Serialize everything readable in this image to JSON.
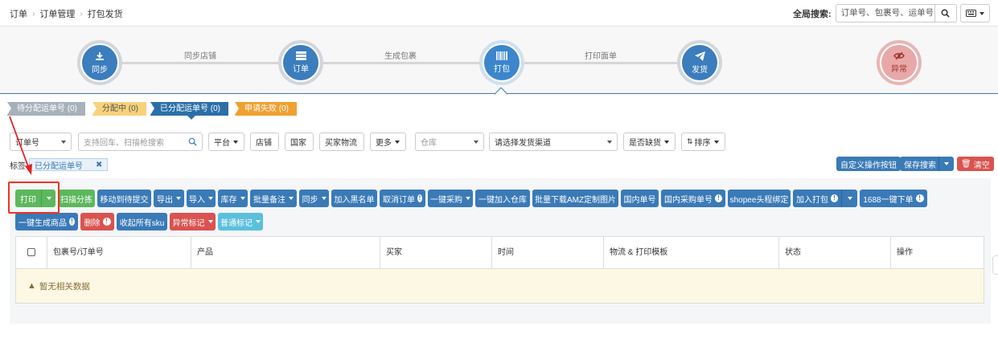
{
  "breadcrumb": [
    "订单",
    "订单管理",
    "打包发货"
  ],
  "global_search": {
    "label": "全局搜索:",
    "placeholder": "订单号、包裹号、运单号",
    "search_icon": "search-icon",
    "keyboard_icon": "keyboard-icon"
  },
  "steps": [
    {
      "label": "同步",
      "icon": "download-icon"
    },
    {
      "label": "订单",
      "icon": "list-icon"
    },
    {
      "label": "打包",
      "icon": "barcode-icon",
      "active": true
    },
    {
      "label": "发货",
      "icon": "paper-plane-icon"
    },
    {
      "label": "异常",
      "icon": "eye-slash-icon"
    }
  ],
  "step_links": [
    "同步店铺",
    "生成包裹",
    "打印面单"
  ],
  "status_tabs": [
    {
      "label": "待分配运单号 (0)"
    },
    {
      "label": "分配中 (0)"
    },
    {
      "label": "已分配运单号 (0)",
      "active": true
    },
    {
      "label": "申请失败 (0)"
    }
  ],
  "filters": {
    "order_no": "订单号",
    "search_placeholder": "支持回车、扫描枪搜索",
    "platform": "平台",
    "store": "店铺",
    "country": "国家",
    "buyer_logistics": "买家物流",
    "more": "更多",
    "warehouse": "仓库",
    "channel": "请选择发货渠道",
    "out_of_stock": "是否缺货",
    "sort": "排序"
  },
  "tag_row": {
    "label": "标签",
    "tag": "已分配运单号"
  },
  "right_buttons": {
    "custom": "自定义操作按钮",
    "save_search": "保存搜索",
    "clear": "清空"
  },
  "action_buttons_row1": [
    "打印",
    "扫描分拣",
    "移动到待提交",
    "导出",
    "导入",
    "库存",
    "批量备注",
    "同步",
    "加入黑名单",
    "取消订单",
    "一键采购",
    "一键加入仓库",
    "批量下载AMZ定制图片",
    "国内单号",
    "国内采购单号",
    "shopee头程绑定",
    "加入打包",
    "1688一键下单"
  ],
  "action_buttons_row2": [
    "一键生成商品",
    "删除",
    "收起所有sku",
    "异常标记",
    "普通标记"
  ],
  "table": {
    "columns": [
      "包裹号/订单号",
      "产品",
      "买家",
      "时间",
      "物流 & 打印模板",
      "状态",
      "操作"
    ],
    "empty_text": "暂无相关数据"
  },
  "colors": {
    "primary": "#3a7ab7",
    "success": "#5cb85c",
    "danger": "#d9534f",
    "info": "#5bc0de",
    "highlight": "#e32222"
  }
}
